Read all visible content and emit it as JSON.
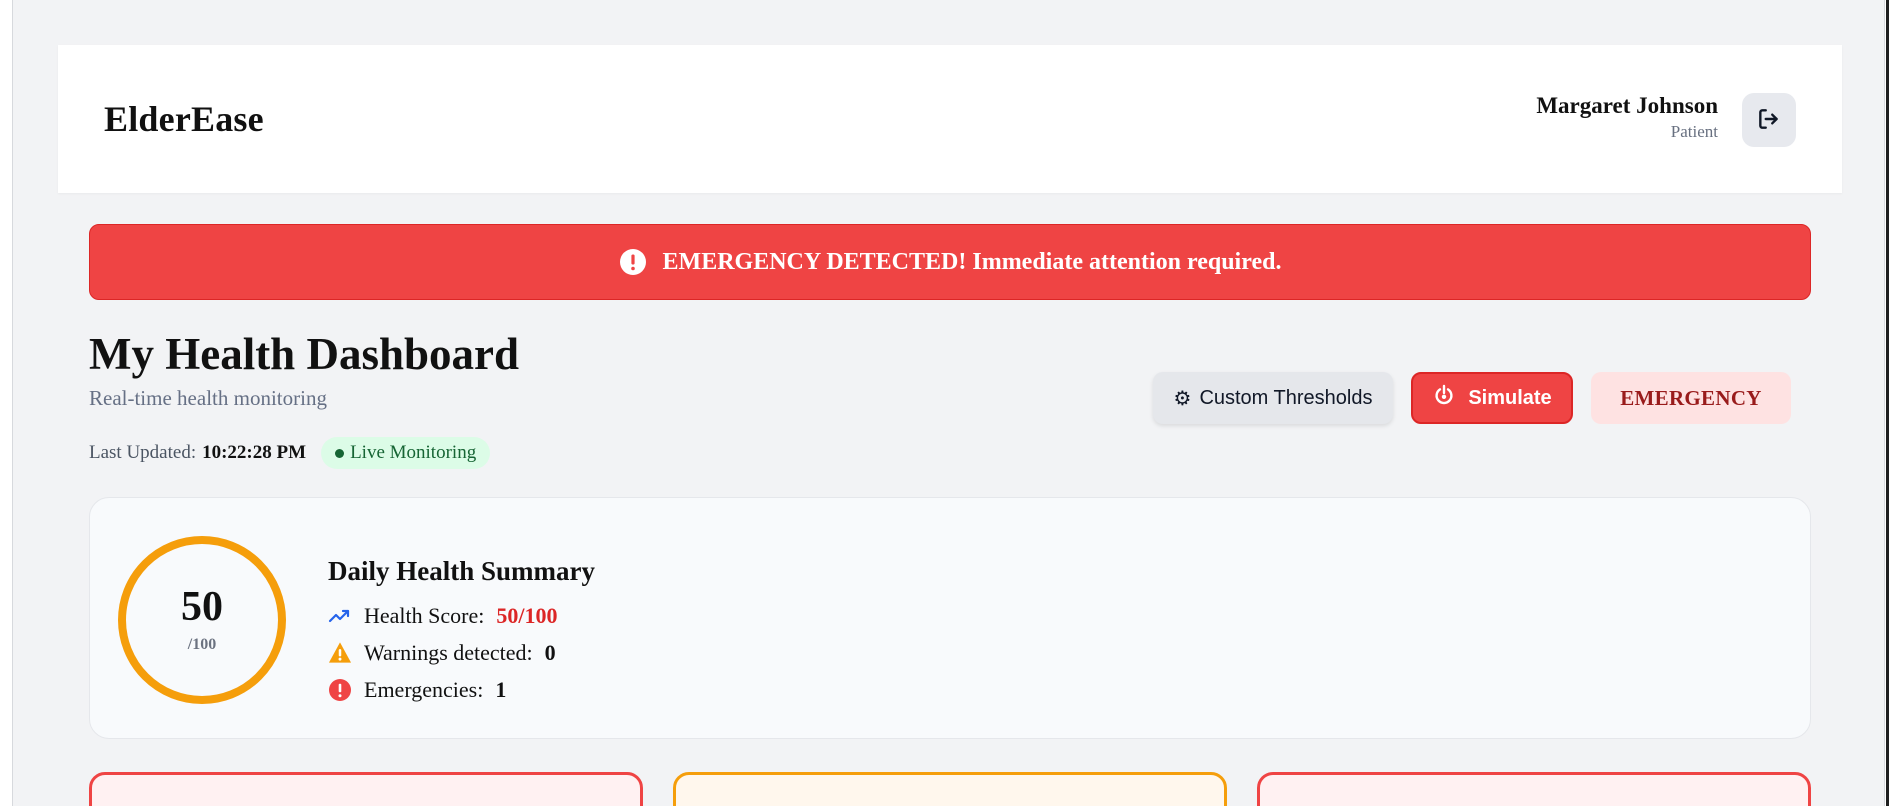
{
  "app": {
    "name": "ElderEase"
  },
  "user": {
    "name": "Margaret Johnson",
    "role": "Patient"
  },
  "alert": {
    "text": "EMERGENCY DETECTED! Immediate attention required."
  },
  "dashboard": {
    "title": "My Health Dashboard",
    "subtitle": "Real-time health monitoring",
    "last_updated_label": "Last Updated:",
    "last_updated_time": "10:22:28 PM",
    "live_status": "Live Monitoring"
  },
  "actions": {
    "thresholds_icon": "⚙",
    "thresholds_label": "Custom Thresholds",
    "simulate_label": "Simulate",
    "status_badge": "EMERGENCY"
  },
  "summary": {
    "score": "50",
    "score_max": "/100",
    "title": "Daily Health Summary",
    "items": [
      {
        "icon": "trending-up-icon",
        "label": "Health Score:",
        "value": "50/100"
      },
      {
        "icon": "warning-icon",
        "label": "Warnings detected:",
        "value": "0"
      },
      {
        "icon": "emergency-alert-icon",
        "label": "Emergencies:",
        "value": "1"
      }
    ]
  },
  "colors": {
    "emergency": "#ef4444",
    "warning": "#f59e0b",
    "live": "#dcfce7",
    "background": "#f2f3f5"
  }
}
